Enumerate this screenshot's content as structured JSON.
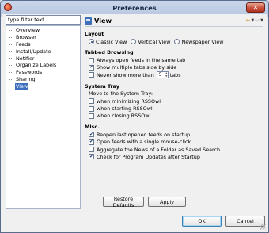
{
  "window": {
    "title": "Preferences",
    "close_glyph": "✕"
  },
  "filter": {
    "value": "type filter text"
  },
  "tree": {
    "items": [
      {
        "label": "Overview"
      },
      {
        "label": "Browser"
      },
      {
        "label": "Feeds"
      },
      {
        "label": "Install/Update"
      },
      {
        "label": "Notifier"
      },
      {
        "label": "Organize Labels"
      },
      {
        "label": "Passwords"
      },
      {
        "label": "Sharing"
      },
      {
        "label": "View",
        "selected": true
      }
    ]
  },
  "page": {
    "title": "View",
    "nav": {
      "back": "⇦",
      "forward": "⇨",
      "dropdown": "▼"
    }
  },
  "layout": {
    "heading": "Layout",
    "options": [
      {
        "label": "Classic View",
        "selected": true
      },
      {
        "label": "Vertical View",
        "selected": false
      },
      {
        "label": "Newspaper View",
        "selected": false
      }
    ]
  },
  "tabbed": {
    "heading": "Tabbed Browsing",
    "always_open": {
      "label": "Always open feeds in the same tab",
      "checked": false
    },
    "side_by_side": {
      "label": "Show multiple tabs side by side",
      "checked": true
    },
    "never_more": {
      "label_before": "Never show more than",
      "value": "5",
      "label_after": "tabs",
      "checked": false
    }
  },
  "tray": {
    "heading": "System Tray",
    "description": "Move to the System Tray:",
    "options": [
      {
        "label": "when minimizing RSSOwl",
        "checked": false
      },
      {
        "label": "when starting RSSOwl",
        "checked": false
      },
      {
        "label": "when closing RSSOwl",
        "checked": false
      }
    ]
  },
  "misc": {
    "heading": "Misc.",
    "options": [
      {
        "label": "Reopen last opened feeds on startup",
        "checked": true
      },
      {
        "label": "Open feeds with a single mouse-click",
        "checked": true
      },
      {
        "label": "Aggregate the News of a Folder as Saved Search",
        "checked": false
      },
      {
        "label": "Check for Program Updates after Startup",
        "checked": true
      }
    ]
  },
  "buttons": {
    "restore_defaults": "Restore Defaults",
    "apply": "Apply",
    "ok": "OK",
    "cancel": "Cancel"
  },
  "check_glyph": "✔"
}
